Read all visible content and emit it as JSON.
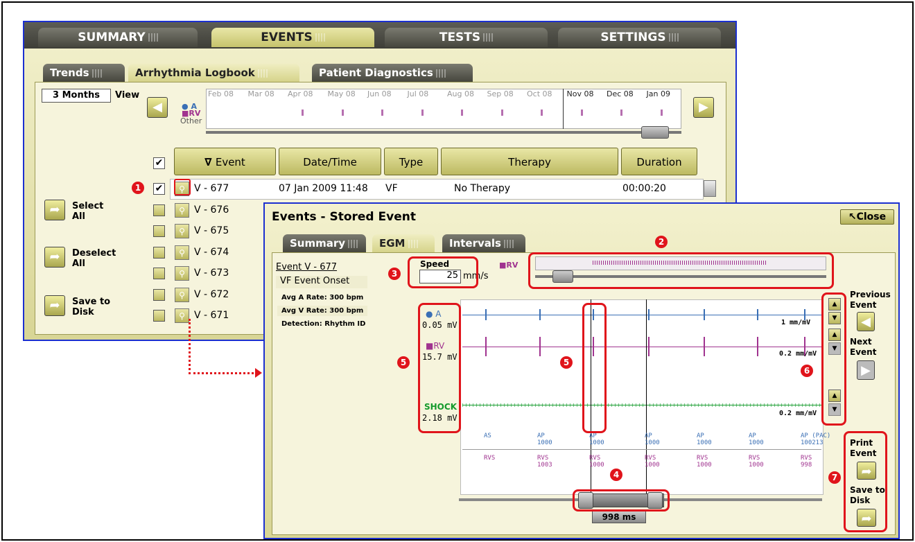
{
  "main_tabs": [
    "SUMMARY",
    "EVENTS",
    "TESTS",
    "SETTINGS"
  ],
  "sub_tabs": [
    "Trends",
    "Arrhythmia Logbook",
    "Patient Diagnostics"
  ],
  "view": {
    "range": "3 Months",
    "label": "View"
  },
  "timeline": {
    "months": [
      "Feb 08",
      "Mar 08",
      "Apr 08",
      "May 08",
      "Jun 08",
      "Jul 08",
      "Aug 08",
      "Sep 08",
      "Oct 08",
      "Nov 08",
      "Dec 08",
      "Jan 09"
    ],
    "legend": [
      "A",
      "RV",
      "Other"
    ]
  },
  "table": {
    "headers": [
      "Event",
      "Date/Time",
      "Type",
      "Therapy",
      "Duration"
    ],
    "first_row": {
      "event": "V - 677",
      "date": "07 Jan 2009 11:48",
      "type": "VF",
      "therapy": "No Therapy",
      "duration": "00:00:20"
    },
    "events": [
      "V - 677",
      "V - 676",
      "V - 675",
      "V - 674",
      "V - 673",
      "V - 672",
      "V - 671"
    ]
  },
  "side_buttons": [
    {
      "label1": "Select",
      "label2": "All"
    },
    {
      "label1": "Deselect",
      "label2": "All"
    },
    {
      "label1": "Save to",
      "label2": "Disk"
    }
  ],
  "dialog": {
    "title": "Events - Stored Event",
    "close": "Close",
    "tabs": [
      "Summary",
      "EGM",
      "Intervals"
    ],
    "event_link": "Event V - 677",
    "event_onset": "VF Event Onset",
    "details": [
      "Avg A Rate: 300  bpm",
      "Avg V Rate: 300  bpm",
      "Detection: Rhythm ID"
    ],
    "speed_label": "Speed",
    "speed_value": "25",
    "speed_unit": "mm/s",
    "strip_label": "RV",
    "channels": [
      {
        "name": "A",
        "value": "0.05 mV",
        "scale": "1 mm/mV",
        "color": "#3a6fb5"
      },
      {
        "name": "RV",
        "value": "15.7 mV",
        "scale": "0.2 mm/mV",
        "color": "#a0338f"
      },
      {
        "name": "SHOCK",
        "value": "2.18 mV",
        "scale": "0.2 mm/mV",
        "color": "#139a2b"
      }
    ],
    "markers_a": [
      "AS",
      "AP\n1000",
      "AP\n1000",
      "AP\n1000",
      "AP\n1000",
      "AP\n1000",
      "AP (PAC)\n100213"
    ],
    "markers_v": [
      "RVS",
      "RVS\n1003",
      "RVS\n1000",
      "RVS\n1000",
      "RVS\n1000",
      "RVS\n1000",
      "RVS\n998"
    ],
    "caliper": "998 ms",
    "prev_label": [
      "Previous",
      "Event"
    ],
    "next_label": [
      "Next",
      "Event"
    ],
    "print_label": [
      "Print",
      "Event"
    ],
    "save_label": [
      "Save to",
      "Disk"
    ]
  },
  "callouts": [
    "1",
    "2",
    "3",
    "4",
    "5",
    "5",
    "6",
    "7"
  ]
}
